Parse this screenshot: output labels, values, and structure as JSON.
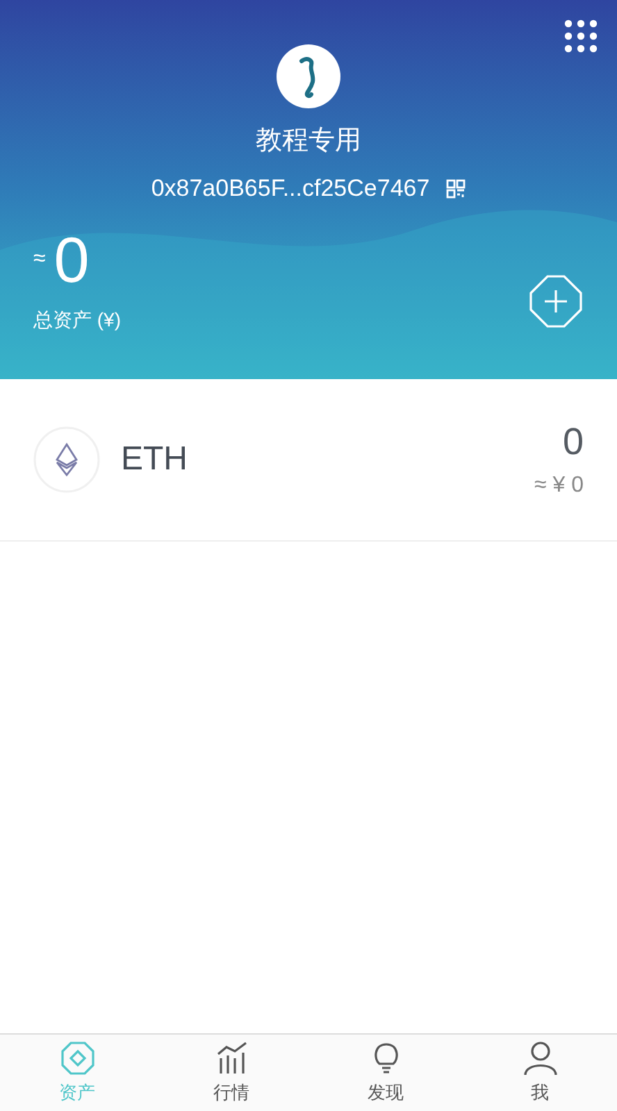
{
  "header": {
    "wallet_name": "教程专用",
    "address": "0x87a0B65F...cf25Ce7467",
    "total_prefix": "≈",
    "total": "0",
    "total_label": "总资产 (¥)"
  },
  "assets": [
    {
      "symbol": "ETH",
      "amount": "0",
      "fiat": "≈ ¥ 0"
    }
  ],
  "tabs": [
    {
      "label": "资产",
      "selected": true
    },
    {
      "label": "行情",
      "selected": false
    },
    {
      "label": "发现",
      "selected": false
    },
    {
      "label": "我",
      "selected": false
    }
  ]
}
